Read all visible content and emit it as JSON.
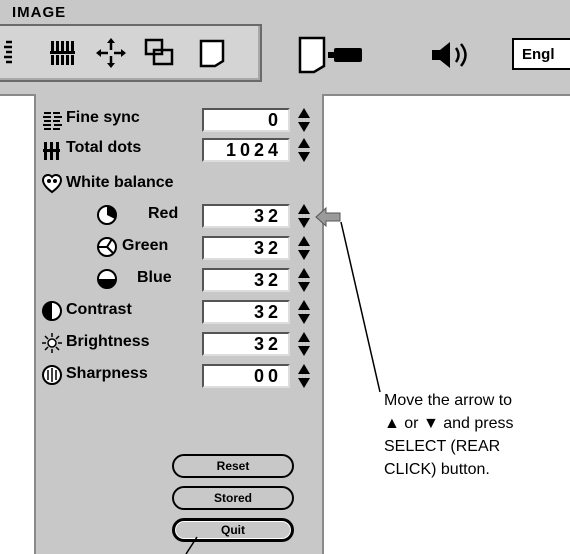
{
  "menu": {
    "title": "IMAGE",
    "language": "Engl"
  },
  "rows": [
    {
      "label": "Fine sync",
      "value": "0",
      "icon": "fine-sync-icon"
    },
    {
      "label": "Total dots",
      "value": "1024",
      "icon": "total-dots-icon"
    },
    {
      "label": "White balance",
      "icon": "white-balance-icon"
    },
    {
      "label": "Red",
      "value": "32",
      "icon": "red-icon"
    },
    {
      "label": "Green",
      "value": "32",
      "icon": "green-icon"
    },
    {
      "label": "Blue",
      "value": "32",
      "icon": "blue-icon"
    },
    {
      "label": "Contrast",
      "value": "32",
      "icon": "contrast-icon"
    },
    {
      "label": "Brightness",
      "value": "32",
      "icon": "brightness-icon"
    },
    {
      "label": "Sharpness",
      "value": "00",
      "icon": "sharpness-icon"
    }
  ],
  "buttons": {
    "reset": "Reset",
    "stored": "Stored",
    "quit": "Quit"
  },
  "annotation": {
    "line1": "Move the arrow to",
    "line2": "▲ or ▼  and press",
    "line3": "SELECT (REAR",
    "line4": "CLICK) button."
  }
}
